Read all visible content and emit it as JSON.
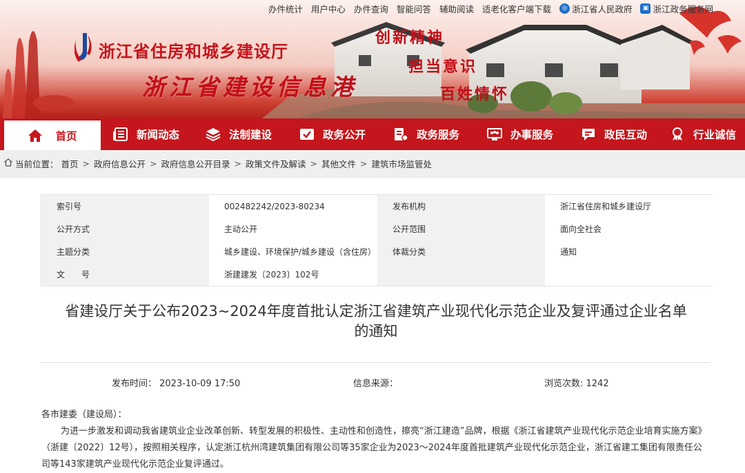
{
  "topbar": {
    "links": [
      "办件统计",
      "用户中心",
      "办件查询",
      "智能问答",
      "辅助阅读",
      "适老化客户端下载"
    ],
    "gov_label": "浙江省人民政府",
    "service_label": "浙江政务服务网"
  },
  "banner": {
    "dept_name": "浙江省住房和城乡建设厅",
    "port_name": "浙江省建设信息港",
    "slogans": [
      "创新精神",
      "担当意识",
      "百姓情怀"
    ]
  },
  "nav": {
    "items": [
      "首页",
      "新闻动态",
      "法制建设",
      "政务公开",
      "政务服务",
      "办事服务",
      "政民互动",
      "行业诚信"
    ]
  },
  "breadcrumb": {
    "label": "当前位置：",
    "items": [
      "首页",
      "政府信息公开",
      "政府信息公开目录",
      "政策文件及解读",
      "其他文件",
      "建筑市场监管处"
    ]
  },
  "meta": {
    "rows": [
      [
        "索引号",
        "002482242/2023-80234",
        "发布机构",
        "浙江省住房和城乡建设厅"
      ],
      [
        "公开方式",
        "主动公开",
        "公开范围",
        "面向全社会"
      ],
      [
        "主题分类",
        "城乡建设、环境保护/城乡建设（含住房）",
        "体裁分类",
        "通知"
      ],
      [
        "文　　号",
        "浙建建发〔2023〕102号",
        "",
        ""
      ]
    ]
  },
  "article": {
    "title_line1": "省建设厅关于公布2023~2024年度首批认定浙江省建筑产业现代化示范企业及复评通过企业名单",
    "title_line2": "的通知",
    "publish_time": "发布时间： 2023-10-09 17:50",
    "source": "信息来源：",
    "views": "浏览次数: 1242",
    "greeting": "各市建委（建设局）：",
    "paragraph": "为进一步激发和调动我省建筑业企业改革创新、转型发展的积极性、主动性和创造性，擦亮“浙江建造”品牌，根据《浙江省建筑产业现代化示范企业培育实施方案》（浙建〔2022〕12号），按照相关程序，认定浙江杭州湾建筑集团有限公司等35家企业为2023～2024年度首批建筑产业现代化示范企业，浙江省建工集团有限责任公司等143家建筑产业现代化示范企业复评通过。"
  },
  "colors": {
    "brand_red": "#c4161c",
    "crumb_bg": "#efefef",
    "meta_key_bg": "#f1f1f1"
  }
}
